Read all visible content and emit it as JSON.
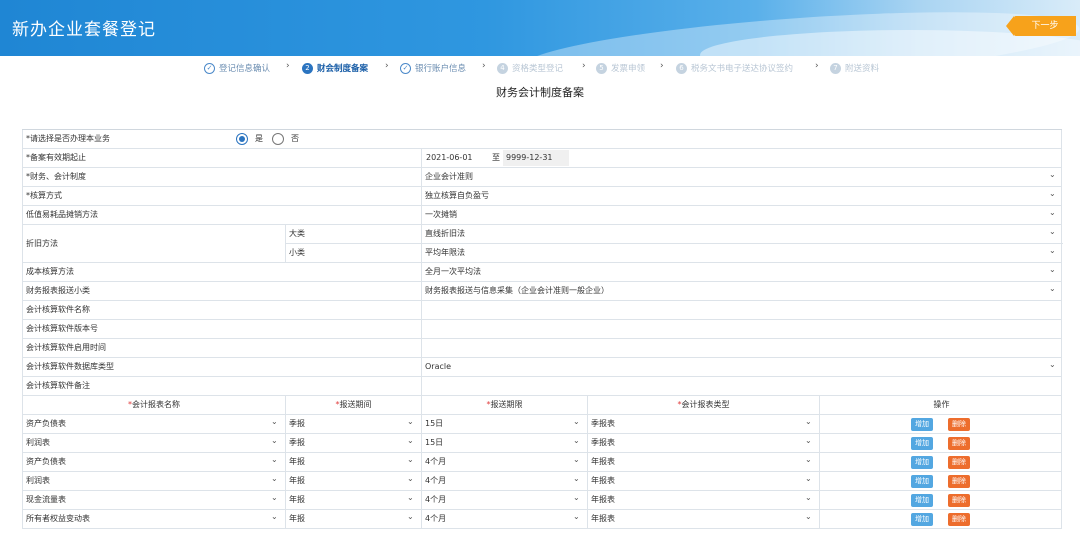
{
  "header": {
    "title": "新办企业套餐登记",
    "next_label": "下一步"
  },
  "steps": [
    {
      "label": "登记信息确认",
      "icon": "check-circle-icon",
      "num": "✓",
      "state": "done"
    },
    {
      "label": "财会制度备案",
      "icon": "number-icon",
      "num": "2",
      "state": "active"
    },
    {
      "label": "银行账户信息",
      "icon": "check-circle-icon",
      "num": "✓",
      "state": "done"
    },
    {
      "label": "资格类型登记",
      "icon": "number-icon",
      "num": "4",
      "state": "future"
    },
    {
      "label": "发票申领",
      "icon": "number-icon",
      "num": "5",
      "state": "future"
    },
    {
      "label": "税务文书电子送达协议签约",
      "icon": "number-icon",
      "num": "6",
      "state": "future"
    },
    {
      "label": "附送资料",
      "icon": "number-icon",
      "num": "7",
      "state": "future"
    }
  ],
  "page_title": "财务会计制度备案",
  "form": {
    "handle_business_label": "*请选择是否办理本业务",
    "yes_label": "是",
    "no_label": "否",
    "selected": "是",
    "valid_period_label": "*备案有效期起止",
    "start_date": "2021-06-01",
    "to_label": "至",
    "end_date": "9999-12-31",
    "rows": [
      {
        "label": "*财务、会计制度",
        "value": "企业会计准则",
        "select": true
      },
      {
        "label": "*核算方式",
        "value": "独立核算自负盈亏",
        "select": true
      },
      {
        "label": "低值易耗品摊销方法",
        "value": "一次摊销",
        "select": true
      }
    ],
    "depreciation": {
      "label": "折旧方法",
      "major_label": "大类",
      "major_value": "直线折旧法",
      "minor_label": "小类",
      "minor_value": "平均年限法"
    },
    "rows2": [
      {
        "label": "成本核算方法",
        "value": "全月一次平均法",
        "select": true
      },
      {
        "label": "财务报表报送小类",
        "value": "财务报表报送与信息采集（企业会计准则一般企业）",
        "select": true
      },
      {
        "label": "会计核算软件名称",
        "value": "",
        "select": false
      },
      {
        "label": "会计核算软件版本号",
        "value": "",
        "select": false
      },
      {
        "label": "会计核算软件启用时间",
        "value": "",
        "select": false
      },
      {
        "label": "会计核算软件数据库类型",
        "value": "Oracle",
        "select": true
      },
      {
        "label": "会计核算软件备注",
        "value": "",
        "select": false
      }
    ]
  },
  "report_table": {
    "headers": [
      "会计报表名称",
      "报送期间",
      "报送期限",
      "会计报表类型",
      "操作"
    ],
    "add_label": "增加",
    "delete_label": "删除",
    "rows": [
      [
        "资产负债表",
        "季报",
        "15日",
        "季报表"
      ],
      [
        "利润表",
        "季报",
        "15日",
        "季报表"
      ],
      [
        "资产负债表",
        "年报",
        "4个月",
        "年报表"
      ],
      [
        "利润表",
        "年报",
        "4个月",
        "年报表"
      ],
      [
        "现金流量表",
        "年报",
        "4个月",
        "年报表"
      ],
      [
        "所有者权益变动表",
        "年报",
        "4个月",
        "年报表"
      ]
    ]
  },
  "colors": {
    "accent": "#2b74c0",
    "header_blue": "#1f86d4",
    "next_orange": "#f7a21b",
    "add_blue": "#53a7e1",
    "delete_orange": "#ed6d2d"
  }
}
